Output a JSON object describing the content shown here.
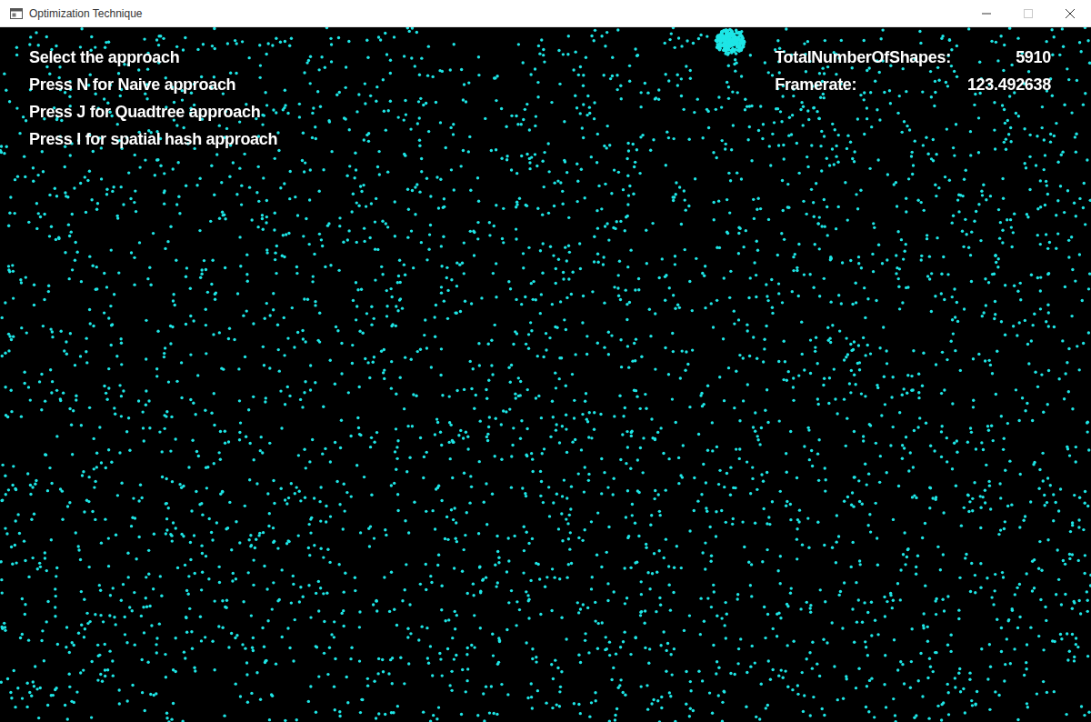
{
  "window": {
    "title": "Optimization Technique",
    "controls": [
      {
        "kind": "minimize",
        "disabled": false
      },
      {
        "kind": "maximize",
        "disabled": true
      },
      {
        "kind": "close",
        "disabled": false
      }
    ]
  },
  "instructions": [
    "Select the approach",
    "Press N for Naive approach",
    "Press J for Quadtree approach",
    "Press I for spatial hash approach"
  ],
  "stats": [
    {
      "label": "TotalNumberOfShapes:",
      "value": "5910"
    },
    {
      "label": "Framerate:",
      "value": "123.492638"
    }
  ]
}
